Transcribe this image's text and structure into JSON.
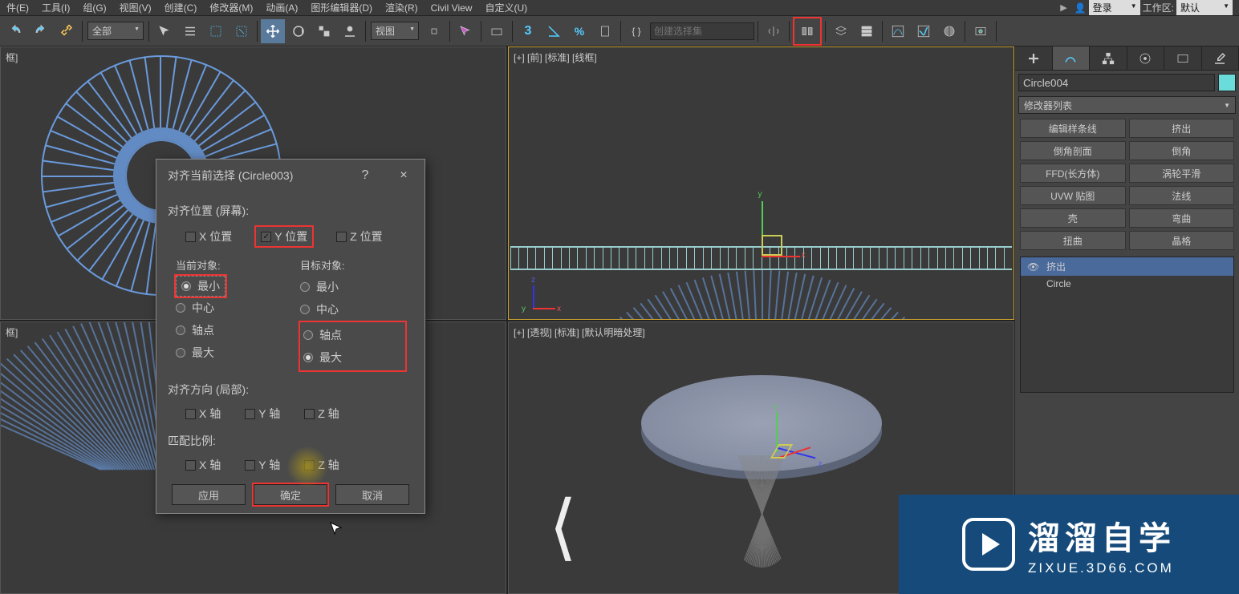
{
  "menubar": {
    "items": [
      "件(E)",
      "工具(I)",
      "组(G)",
      "视图(V)",
      "创建(C)",
      "修改器(M)",
      "动画(A)",
      "图形编辑器(D)",
      "渲染(R)",
      "Civil View",
      "自定义(U)"
    ],
    "login_label": "登录",
    "workspace_label": "工作区:",
    "workspace_value": "默认"
  },
  "toolbar": {
    "filter_dropdown": "全部",
    "view_dropdown": "视图",
    "selection_set_placeholder": "创建选择集"
  },
  "viewports": {
    "top_left": "框]",
    "top_right": "[+] [前] [标准] [线框]",
    "bottom_left": "框]",
    "bottom_right": "[+] [透视] [标准] [默认明暗处理]"
  },
  "command_panel": {
    "object_name": "Circle004",
    "modifier_list_label": "修改器列表",
    "buttons": {
      "edit_spline": "编辑样条线",
      "extrude": "挤出",
      "chamfer_profile": "倒角剖面",
      "chamfer": "倒角",
      "ffd_box": "FFD(长方体)",
      "turbosmooth": "涡轮平滑",
      "uvw_map": "UVW 贴图",
      "normal": "法线",
      "shell": "壳",
      "bend": "弯曲",
      "twist": "扭曲",
      "lattice": "晶格"
    },
    "stack": {
      "item0": "挤出",
      "item1": "Circle"
    }
  },
  "align_dialog": {
    "title": "对齐当前选择 (Circle003)",
    "help": "?",
    "close": "×",
    "align_position_label": "对齐位置 (屏幕):",
    "x_pos": "X 位置",
    "y_pos": "Y 位置",
    "z_pos": "Z 位置",
    "current_object_label": "当前对象:",
    "target_object_label": "目标对象:",
    "opt_min": "最小",
    "opt_center": "中心",
    "opt_pivot": "轴点",
    "opt_max": "最大",
    "align_orientation_label": "对齐方向 (局部):",
    "x_axis": "X 轴",
    "y_axis": "Y 轴",
    "z_axis": "Z 轴",
    "match_scale_label": "匹配比例:",
    "btn_apply": "应用",
    "btn_ok": "确定",
    "btn_cancel": "取消"
  },
  "watermark": {
    "big": "溜溜自学",
    "small": "ZIXUE.3D66.COM"
  },
  "axes": {
    "x": "x",
    "y": "y",
    "z": "z"
  }
}
